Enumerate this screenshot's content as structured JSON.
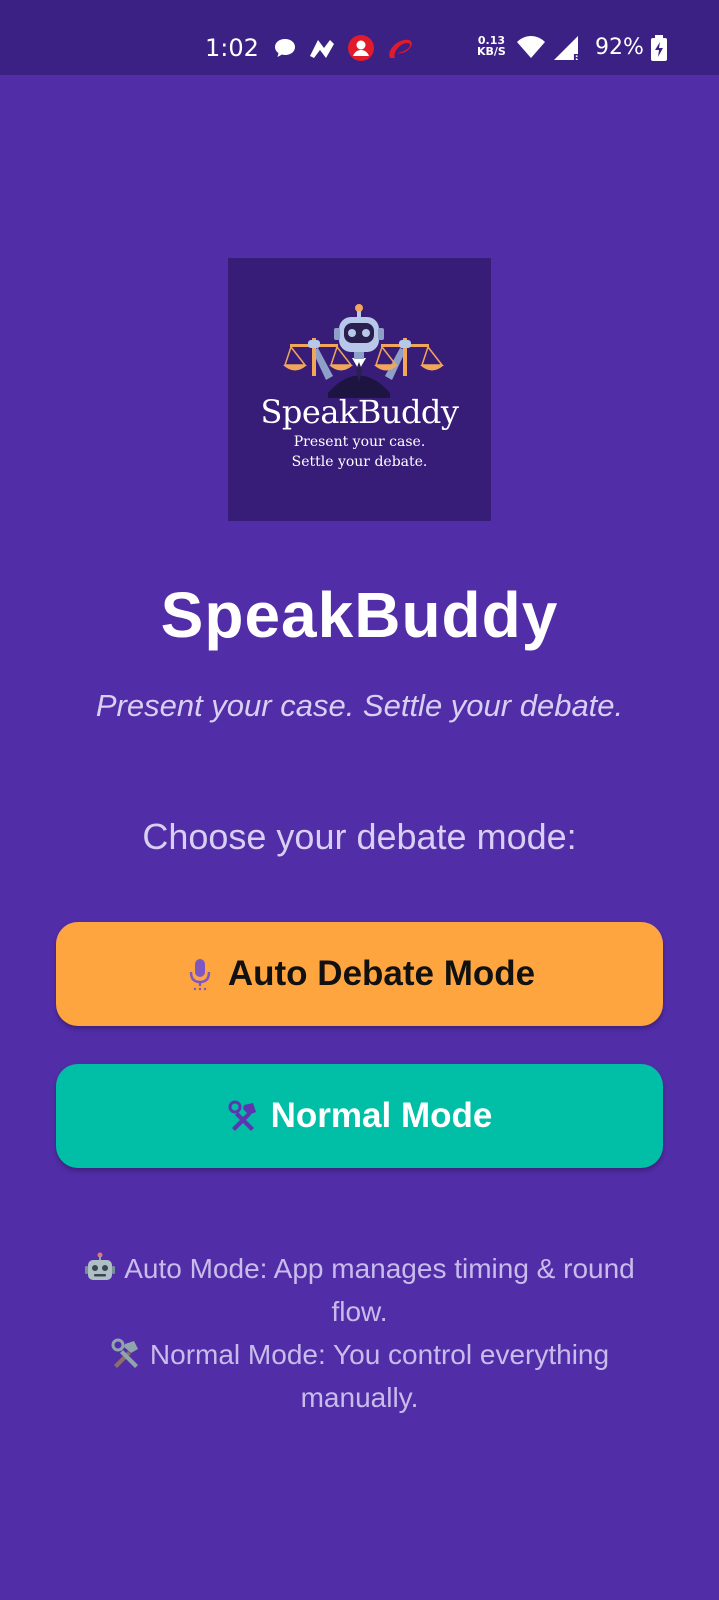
{
  "status_bar": {
    "time": "1:02",
    "net_speed_value": "0.13",
    "net_speed_unit": "KB/S",
    "battery_percent": "92%",
    "icons": [
      "chat-bubble-icon",
      "app-notification-icon",
      "user-avatar-icon",
      "airtel-icon",
      "wifi-icon",
      "cell-signal-icon",
      "battery-charging-icon"
    ]
  },
  "logo": {
    "title": "SpeakBuddy",
    "line1": "Present your case.",
    "line2": "Settle your debate.",
    "colors": {
      "background": "#371C78",
      "scales": "#F2A65A",
      "robot": "#B8C8E8"
    }
  },
  "header": {
    "title": "SpeakBuddy",
    "tagline": "Present your case. Settle your debate."
  },
  "mode_select": {
    "prompt": "Choose your debate mode:",
    "auto_button": {
      "label": "Auto Debate Mode",
      "icon": "microphone-icon",
      "color": "#FFA53F"
    },
    "normal_button": {
      "label": "Normal Mode",
      "icon": "hammer-wrench-icon",
      "color": "#00BFA6"
    }
  },
  "help": {
    "auto_icon": "robot-icon",
    "auto_text": "Auto Mode: App manages timing & round flow.",
    "normal_icon": "tools-icon",
    "normal_text": "Normal Mode: You control everything manually."
  },
  "theme": {
    "background": "#512DA8",
    "status_bar": "#3B2184"
  }
}
